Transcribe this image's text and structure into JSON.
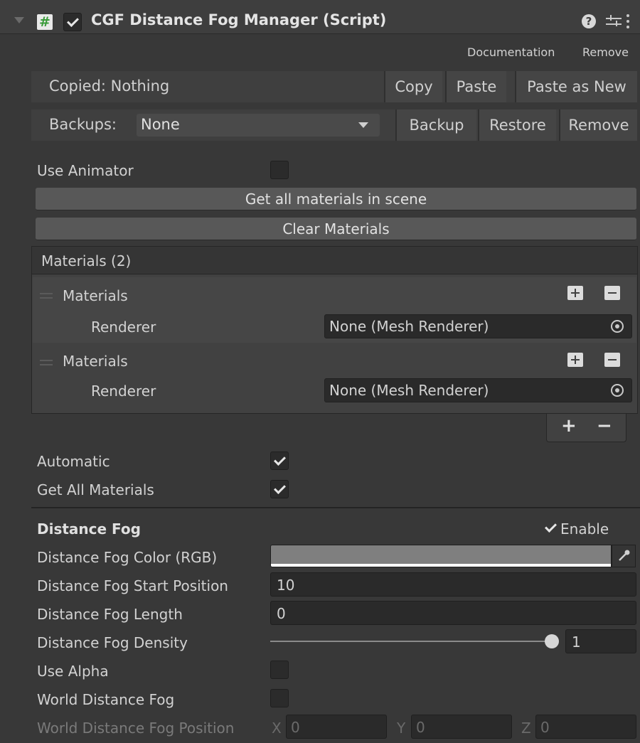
{
  "component": {
    "title": "CGF Distance Fog Manager (Script)",
    "script_icon_glyph": "#",
    "enabled": true,
    "icons": [
      "foldout-triangle-icon",
      "script-icon",
      "help-icon",
      "preset-icon",
      "kebab-menu-icon"
    ]
  },
  "links": {
    "documentation": "Documentation",
    "remove": "Remove"
  },
  "copy_bar": {
    "status": "Copied: Nothing",
    "copy": "Copy",
    "paste": "Paste",
    "paste_as_new": "Paste as New"
  },
  "backup_bar": {
    "label": "Backups:",
    "selected": "None",
    "backup": "Backup",
    "restore": "Restore",
    "remove": "Remove"
  },
  "use_animator": {
    "label": "Use Animator",
    "checked": false
  },
  "buttons": {
    "get_all": "Get all materials in scene",
    "clear": "Clear Materials"
  },
  "materials_list": {
    "header": "Materials (2)",
    "items": [
      {
        "label": "Materials",
        "field_label": "Renderer",
        "value": "None (Mesh Renderer)"
      },
      {
        "label": "Materials",
        "field_label": "Renderer",
        "value": "None (Mesh Renderer)"
      }
    ],
    "footer_add": "+",
    "footer_remove": "−"
  },
  "automatic": {
    "label": "Automatic",
    "checked": true
  },
  "get_all_materials": {
    "label": "Get All Materials",
    "checked": true
  },
  "distance_fog": {
    "section_label": "Distance Fog",
    "enable_label": "Enable",
    "enabled": true,
    "color_label": "Distance Fog Color (RGB)",
    "color": "#7f7f7f",
    "start_label": "Distance Fog Start Position",
    "start_value": "10",
    "length_label": "Distance Fog Length",
    "length_value": "0",
    "density_label": "Distance Fog Density",
    "density_value": "1",
    "density_fraction": 1.0,
    "use_alpha_label": "Use Alpha",
    "use_alpha": false,
    "world_fog_label": "World Distance Fog",
    "world_fog": false,
    "world_position_label": "World Distance Fog Position",
    "x_label": "X",
    "x_value": "0",
    "y_label": "Y",
    "y_value": "0",
    "z_label": "Z",
    "z_value": "0"
  },
  "colors": {
    "background": "#383838",
    "header": "#3e3e3e",
    "field": "#2a2a2a",
    "button": "#585858",
    "script_icon_green": "#3a9b3a"
  }
}
